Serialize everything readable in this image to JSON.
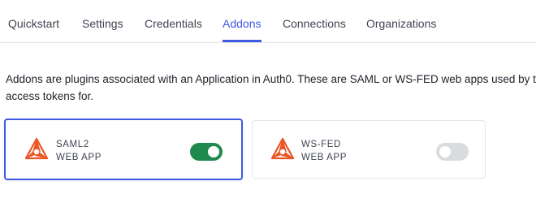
{
  "tabs": [
    {
      "label": "Quickstart",
      "active": false
    },
    {
      "label": "Settings",
      "active": false
    },
    {
      "label": "Credentials",
      "active": false
    },
    {
      "label": "Addons",
      "active": true
    },
    {
      "label": "Connections",
      "active": false
    },
    {
      "label": "Organizations",
      "active": false
    }
  ],
  "description": {
    "line1": "Addons are plugins associated with an Application in Auth0. These are SAML or WS-FED web apps used by the",
    "line2": "access tokens for."
  },
  "addons": [
    {
      "line1": "SAML2",
      "line2": "WEB APP",
      "enabled": true,
      "selected": true,
      "icon": "auth0-logo-icon"
    },
    {
      "line1": "WS-FED",
      "line2": "WEB APP",
      "enabled": false,
      "selected": false,
      "icon": "auth0-logo-icon"
    }
  ],
  "colors": {
    "accent": "#3f59e4",
    "toggle_on": "#1f8a4c",
    "toggle_off": "#d9dbde",
    "logo_red": "#eb5424"
  }
}
